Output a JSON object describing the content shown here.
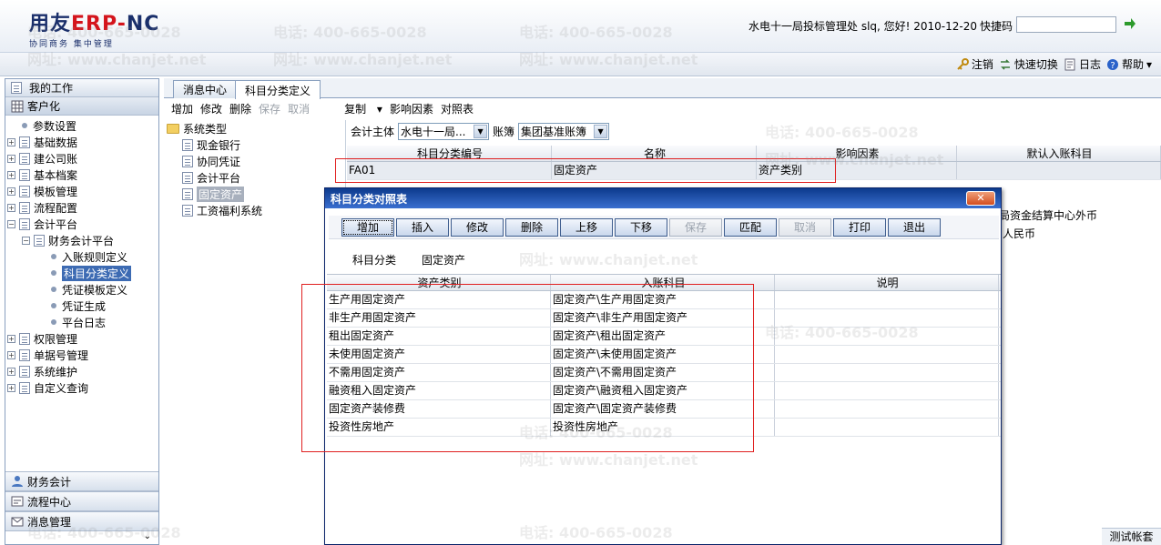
{
  "header": {
    "brand_main": "用友",
    "brand_erp": "ERP-",
    "brand_nc": "NC",
    "slogan": "协同商务  集中管理",
    "user_line": "水电十一局投标管理处 slq, 您好! 2010-12-20",
    "quick_code_label": "快捷码",
    "quick_code_value": ""
  },
  "toplinks": {
    "logout": "注销",
    "quick_switch": "快速切换",
    "log": "日志",
    "help": "帮助"
  },
  "leftnav": {
    "my_work": "我的工作",
    "customize": "客户化",
    "tree": [
      {
        "label": "参数设置"
      },
      {
        "label": "基础数据"
      },
      {
        "label": "建公司账"
      },
      {
        "label": "基本档案"
      },
      {
        "label": "模板管理"
      },
      {
        "label": "流程配置"
      },
      {
        "label": "会计平台"
      },
      {
        "label": "财务会计平台"
      },
      {
        "label": "入账规则定义"
      },
      {
        "label": "科目分类定义"
      },
      {
        "label": "凭证模板定义"
      },
      {
        "label": "凭证生成"
      },
      {
        "label": "平台日志"
      },
      {
        "label": "权限管理"
      },
      {
        "label": "单据号管理"
      },
      {
        "label": "系统维护"
      },
      {
        "label": "自定义查询"
      }
    ],
    "bottom": {
      "fin_accounting": "财务会计",
      "process_center": "流程中心",
      "message_mgmt": "消息管理"
    }
  },
  "tabs": {
    "message_center": "消息中心",
    "subject_class_def": "科目分类定义"
  },
  "maintools": {
    "add": "增加",
    "modify": "修改",
    "delete": "删除",
    "save": "保存",
    "cancel": "取消",
    "copy": "复制",
    "influence": "影响因素",
    "mapping": "对照表"
  },
  "systree": {
    "root": "系统类型",
    "items": [
      "现金银行",
      "协同凭证",
      "会计平台",
      "固定资产",
      "工资福利系统"
    ]
  },
  "filters": {
    "entity_label": "会计主体",
    "entity_value": "水电十一局...",
    "book_label": "账簿",
    "book_value": "集团基准账簿"
  },
  "grid": {
    "headers": [
      "科目分类编号",
      "名称",
      "影响因素",
      "默认入账科目"
    ],
    "row": {
      "code": "FA01",
      "name": "固定资产",
      "factor": "资产类别"
    },
    "right_text_1": "局资金结算中心外币",
    "right_text_2": "人民币"
  },
  "dialog": {
    "title": "科目分类对照表",
    "close": "✕",
    "buttons": {
      "add": "增加",
      "insert": "插入",
      "modify": "修改",
      "delete": "删除",
      "up": "上移",
      "down": "下移",
      "save": "保存",
      "match": "匹配",
      "cancel": "取消",
      "print": "打印",
      "exit": "退出"
    },
    "info_label": "科目分类",
    "info_value": "固定资产",
    "headers": [
      "资产类别",
      "入账科目",
      "说明"
    ],
    "rows": [
      [
        "生产用固定资产",
        "固定资产\\生产用固定资产",
        ""
      ],
      [
        "非生产用固定资产",
        "固定资产\\非生产用固定资产",
        ""
      ],
      [
        "租出固定资产",
        "固定资产\\租出固定资产",
        ""
      ],
      [
        "未使用固定资产",
        "固定资产\\未使用固定资产",
        ""
      ],
      [
        "不需用固定资产",
        "固定资产\\不需用固定资产",
        ""
      ],
      [
        "融资租入固定资产",
        "固定资产\\融资租入固定资产",
        ""
      ],
      [
        "固定资产装修费",
        "固定资产\\固定资产装修费",
        ""
      ],
      [
        "投资性房地产",
        "投资性房地产",
        ""
      ]
    ]
  },
  "status": {
    "test_book": "测试帐套"
  },
  "watermarks": {
    "phone": "电话: 400-665-0028",
    "site": "网址: www.chanjet.net"
  },
  "colors": {
    "title_bar": "#0c3a8c",
    "selection": "#3d6bb3",
    "highlight_box": "#e02020"
  }
}
